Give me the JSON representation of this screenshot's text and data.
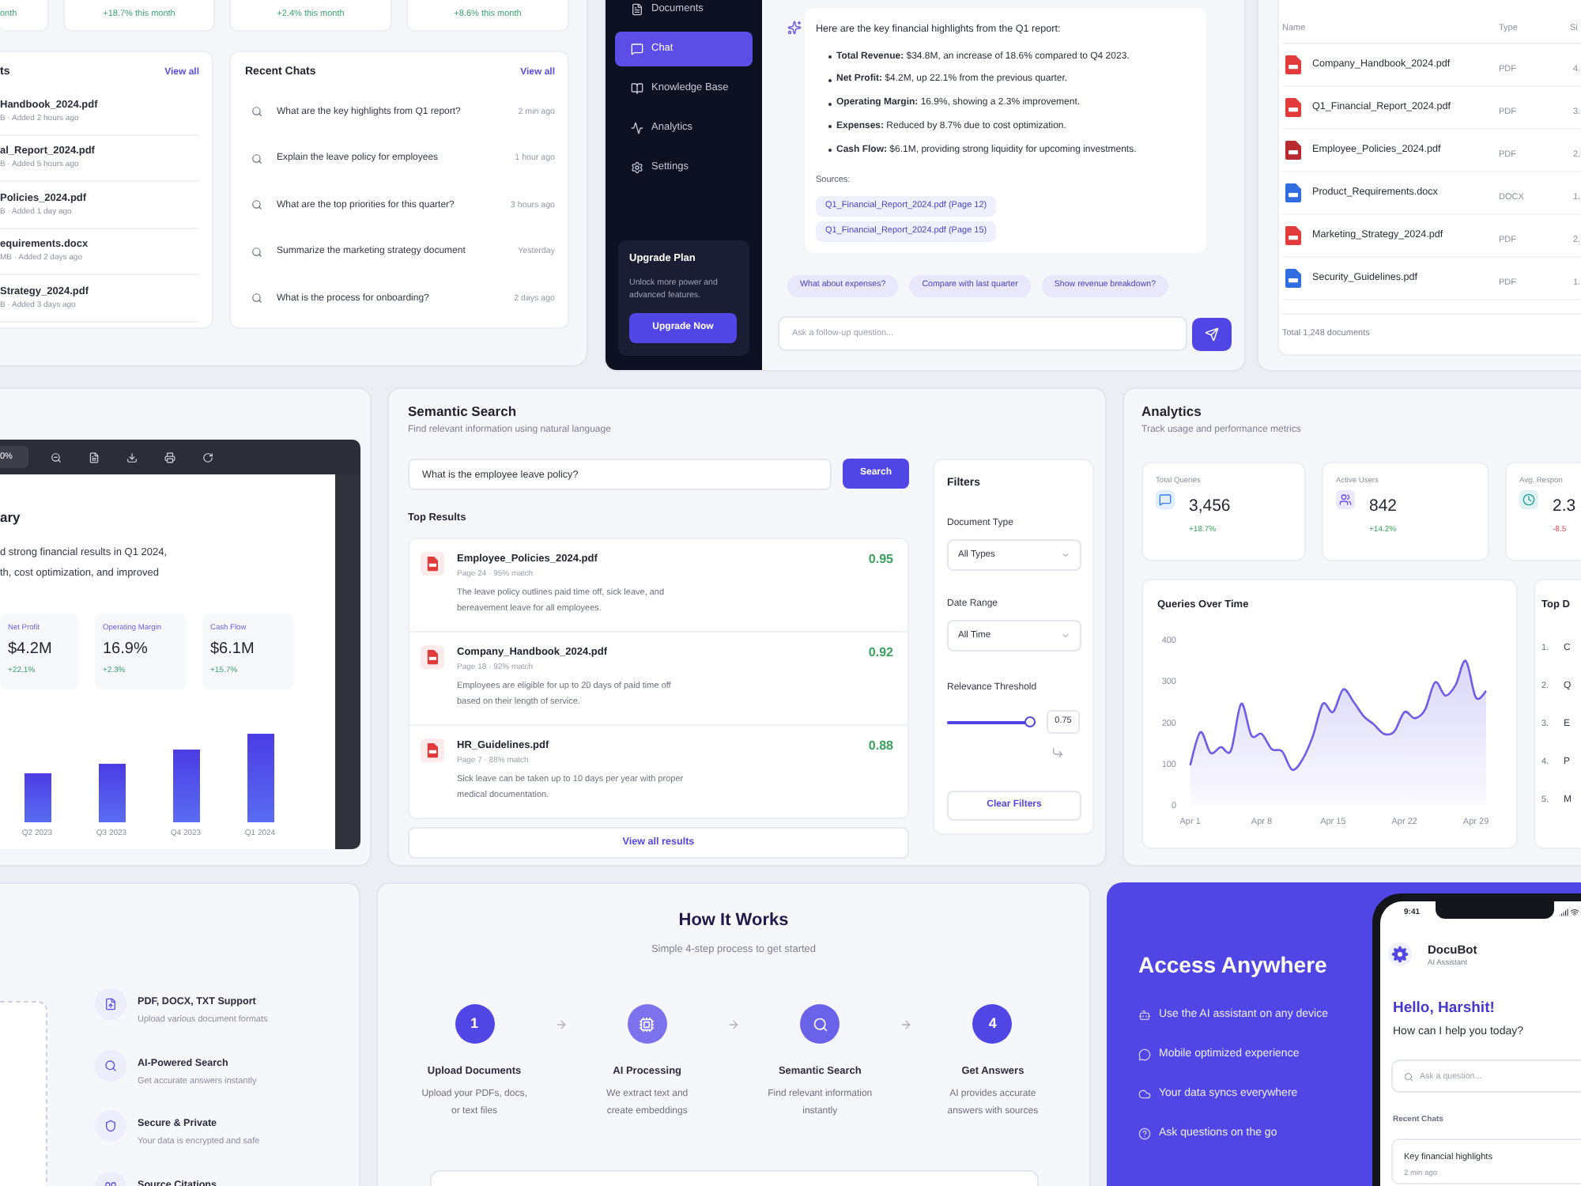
{
  "dashboard": {
    "stat_changes": [
      "onth",
      "+18.7% this month",
      "+2.4% this month",
      "+8.6% this month"
    ],
    "recent_documents": {
      "title": "ts",
      "link": "View all",
      "items": [
        {
          "name": "Handbook_2024.pdf",
          "meta": "B · Added 2 hours ago"
        },
        {
          "name": "al_Report_2024.pdf",
          "meta": "B · Added 5 hours ago"
        },
        {
          "name": "Policies_2024.pdf",
          "meta": "B · Added 1 day ago"
        },
        {
          "name": "equirements.docx",
          "meta": "MB · Added 2 days ago"
        },
        {
          "name": "Strategy_2024.pdf",
          "meta": "B · Added 3 days ago"
        }
      ]
    },
    "recent_chats": {
      "title": "Recent Chats",
      "link": "View all",
      "items": [
        {
          "question": "What are the key highlights from Q1 report?",
          "time": "2 min ago"
        },
        {
          "question": "Explain the leave policy for employees",
          "time": "1 hour ago"
        },
        {
          "question": "What are the top priorities for this quarter?",
          "time": "3 hours ago"
        },
        {
          "question": "Summarize the marketing strategy document",
          "time": "Yesterday"
        },
        {
          "question": "What is the process for onboarding?",
          "time": "2 days ago"
        }
      ]
    }
  },
  "chat_app": {
    "sidebar": [
      {
        "label": "Documents",
        "selected": false
      },
      {
        "label": "Chat",
        "selected": true
      },
      {
        "label": "Knowledge Base",
        "selected": false
      },
      {
        "label": "Analytics",
        "selected": false
      },
      {
        "label": "Settings",
        "selected": false
      }
    ],
    "upgrade": {
      "title": "Upgrade Plan",
      "text": "Unlock more power and advanced features.",
      "button": "Upgrade Now"
    },
    "message": {
      "intro": "Here are the key financial highlights from the Q1 report:",
      "bullets": [
        "**Total Revenue:** $34.8M, an increase of 18.6% compared to Q4 2023.",
        "**Net Profit:** $4.2M, up 22.1% from the previous quarter.",
        "**Operating Margin:** 16.9%, showing a 2.3% improvement.",
        "**Expenses:** Reduced by 8.7% due to cost optimization.",
        "**Cash Flow:** $6.1M, providing strong liquidity for upcoming investments."
      ],
      "sources_label": "Sources:",
      "sources": [
        "Q1_Financial_Report_2024.pdf (Page 12)",
        "Q1_Financial_Report_2024.pdf (Page 15)"
      ]
    },
    "suggestions": [
      "What about expenses?",
      "Compare with last quarter",
      "Show revenue breakdown?"
    ],
    "input": {
      "placeholder": "Ask a follow-up question..."
    }
  },
  "documents_table": {
    "columns": [
      "Name",
      "Type",
      "Si"
    ],
    "rows": [
      {
        "name": "Company_Handbook_2024.pdf",
        "type": "PDF",
        "column_3": "4.",
        "color": "#e23b3b"
      },
      {
        "name": "Q1_Financial_Report_2024.pdf",
        "type": "PDF",
        "column_3": "3.",
        "color": "#e23b3b"
      },
      {
        "name": "Employee_Policies_2024.pdf",
        "type": "PDF",
        "column_3": "2.",
        "color": "#b92a30"
      },
      {
        "name": "Product_Requirements.docx",
        "type": "DOCX",
        "column_3": "1.",
        "color": "#2f6de1"
      },
      {
        "name": "Marketing_Strategy_2024.pdf",
        "type": "PDF",
        "column_3": "2.",
        "color": "#e23b3b"
      },
      {
        "name": "Security_Guidelines.pdf",
        "type": "PDF",
        "column_3": "1.",
        "color": "#2f6de1"
      }
    ],
    "footer": "Total 1,248 documents"
  },
  "document_viewer": {
    "zoom": "0%",
    "title": "ary",
    "lines": [
      "d strong financial results in Q1 2024,",
      "th, cost optimization, and improved"
    ],
    "metrics": [
      {
        "label": "Net Profit",
        "value": "$4.2M",
        "change": "+22.1%"
      },
      {
        "label": "Operating Margin",
        "value": "16.9%",
        "change": "+2.3%"
      },
      {
        "label": "Cash Flow",
        "value": "$6.1M",
        "change": "+15.7%"
      }
    ],
    "bar_labels": [
      "Q2 2023",
      "Q3 2023",
      "Q4 2023",
      "Q1 2024"
    ]
  },
  "semantic_search": {
    "title": "Semantic Search",
    "subtitle": "Find relevant information using natural language",
    "query": "What is the employee leave policy?",
    "button": "Search",
    "results_title": "Top Results",
    "results": [
      {
        "name": "Employee_Policies_2024.pdf",
        "meta": "Page 24 · 95% match",
        "snippet": "The leave policy outlines paid time off, sick leave, and bereavement leave for all employees.",
        "score": "0.95"
      },
      {
        "name": "Company_Handbook_2024.pdf",
        "meta": "Page 18 · 92% match",
        "snippet": "Employees are eligible for up to 20 days of paid time off based on their length of service.",
        "score": "0.92"
      },
      {
        "name": "HR_Guidelines.pdf",
        "meta": "Page 7 · 88% match",
        "snippet": "Sick leave can be taken up to 10 days per year with proper medical documentation.",
        "score": "0.88"
      }
    ],
    "view_all": "View all results",
    "filters": {
      "title": "Filters",
      "fields": [
        {
          "label": "Document Type",
          "value": "All Types"
        },
        {
          "label": "Date Range",
          "value": "All Time"
        }
      ],
      "threshold": {
        "label": "Relevance Threshold",
        "level": 1,
        "value": "0.75"
      },
      "button": "Clear Filters"
    }
  },
  "analytics": {
    "title": "Analytics",
    "subtitle": "Track usage and performance metrics",
    "stats": [
      {
        "label": "Total Queries",
        "value": "3,456",
        "change": "+18.7%",
        "negative": false,
        "color": "#2f80ed"
      },
      {
        "label": "Active Users",
        "value": "842",
        "change": "+14.2%",
        "negative": false,
        "color": "#6a4fe6"
      },
      {
        "label": "Avg. Respon",
        "value": "2.3",
        "change": "-8.5",
        "negative": true,
        "color": "#16a39c"
      }
    ],
    "chart_data": {
      "type": "area",
      "title": "Queries Over Time",
      "categories": [
        "Apr 1",
        null,
        null,
        null,
        null,
        null,
        null,
        "Apr 8",
        null,
        null,
        null,
        null,
        null,
        null,
        "Apr 15",
        null,
        null,
        null,
        null,
        null,
        null,
        "Apr 22",
        null,
        null,
        null,
        null,
        null,
        null,
        "Apr 29",
        null
      ],
      "series": [
        {
          "color": "#6c5ce7",
          "values": [
            96,
            176,
            126,
            140,
            132,
            245,
            168,
            172,
            135,
            130,
            85,
            110,
            165,
            245,
            225,
            280,
            250,
            215,
            195,
            172,
            178,
            225,
            210,
            230,
            297,
            265,
            290,
            349,
            260,
            276
          ]
        }
      ],
      "ylim": [
        0,
        400
      ],
      "yticks": [
        0,
        100,
        200,
        300,
        400
      ]
    },
    "top": {
      "title": "Top D",
      "items": [
        {
          "rank": "1.",
          "text": "C"
        },
        {
          "rank": "2.",
          "text": "Q"
        },
        {
          "rank": "3.",
          "text": "E"
        },
        {
          "rank": "4.",
          "text": "P"
        },
        {
          "rank": "5.",
          "text": "M"
        }
      ]
    }
  },
  "features": [
    {
      "title": "PDF, DOCX, TXT Support",
      "text": "Upload various document formats"
    },
    {
      "title": "AI-Powered Search",
      "text": "Get accurate answers instantly"
    },
    {
      "title": "Secure & Private",
      "text": "Your data is encrypted and safe"
    },
    {
      "title": "Source Citations"
    }
  ],
  "how_it_works": {
    "title": "How It Works",
    "subtitle": "Simple 4-step process to get started",
    "steps": [
      {
        "kind": "number",
        "marker": "1",
        "title": "Upload Documents",
        "text": "Upload your PDFs, docs, or text files"
      },
      {
        "kind": "chip",
        "title": "AI Processing",
        "text": "We extract text and create embeddings"
      },
      {
        "kind": "search",
        "title": "Semantic Search",
        "text": "Find relevant information instantly"
      },
      {
        "kind": "number",
        "marker": "4",
        "title": "Get Answers",
        "text": "AI provides accurate answers with sources"
      }
    ]
  },
  "access": {
    "title": "Access Anywhere",
    "items": [
      "Use the AI assistant on any device",
      "Mobile optimized experience",
      "Your data syncs everywhere",
      "Ask questions on the go"
    ],
    "phone": {
      "time": "9:41",
      "app_name": "DocuBot",
      "app_subtitle": "AI Assistant",
      "greeting": "Hello, Harshit!",
      "prompt": "How can I help you today?",
      "search_placeholder": "Ask a question...",
      "recent_title": "Recent Chats",
      "recent": [
        {
          "title": "Key financial highlights",
          "time": "2 min ago"
        }
      ]
    }
  }
}
